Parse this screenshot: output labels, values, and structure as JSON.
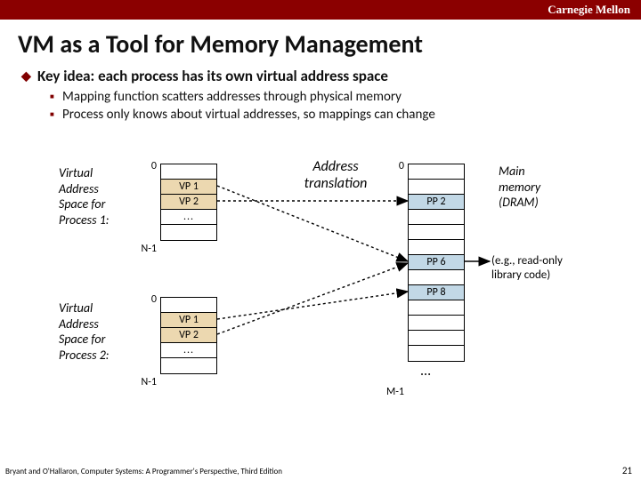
{
  "header": {
    "org": "Carnegie Mellon"
  },
  "title": "VM as a Tool for Memory Management",
  "bullets": {
    "main": "Key idea: each process has its own virtual address space",
    "sub1": "Mapping function scatters addresses through physical memory",
    "sub2": "Process only knows about virtual addresses, so mappings can change"
  },
  "diagram": {
    "vas1_label": "Virtual\nAddress\nSpace for\nProcess 1:",
    "vas2_label": "Virtual\nAddress\nSpace for\nProcess 2:",
    "atrans": "Address\ntranslation",
    "mainmem": "Main\nmemory\n(DRAM)",
    "readonly": "(e.g., read-only\nlibrary code)",
    "zero": "0",
    "nminus1": "N-1",
    "mminus1": "M-1",
    "vp1": "VP 1",
    "vp2": "VP 2",
    "pp2": "PP 2",
    "pp6": "PP 6",
    "pp8": "PP 8",
    "dots": "...",
    "bigdots": "..."
  },
  "footer": "Bryant and O'Hallaron, Computer Systems: A Programmer's Perspective, Third Edition",
  "page": "21"
}
